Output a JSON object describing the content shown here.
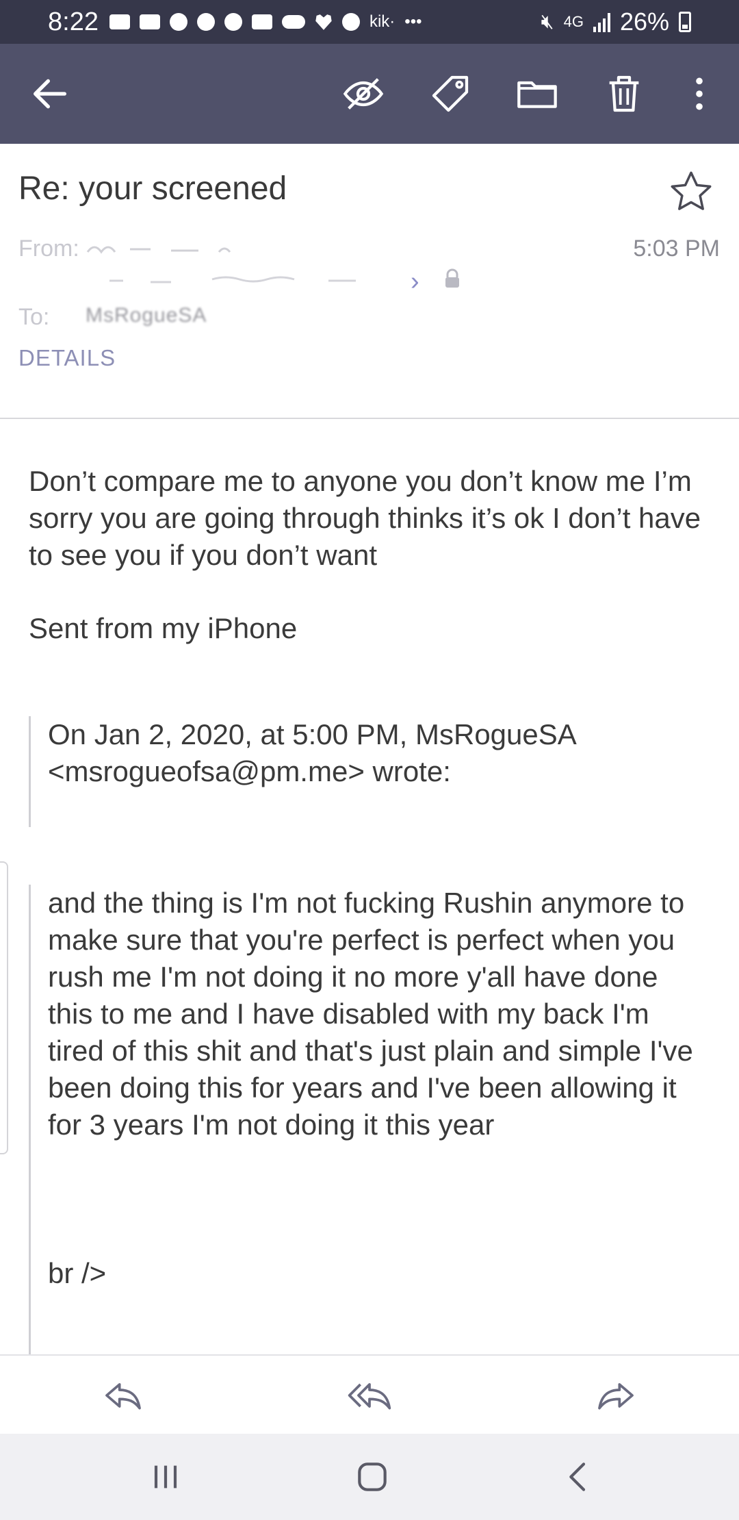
{
  "status_bar": {
    "time": "8:22",
    "battery": "26%",
    "network": "4G",
    "more": "•••",
    "kik": "kik·"
  },
  "toolbar": {
    "back": "back",
    "mark_unread": "mark-unread",
    "label": "label",
    "move": "move-to-folder",
    "delete": "delete",
    "more": "more"
  },
  "message": {
    "subject": "Re: your screened",
    "from_label": "From:",
    "time": "5:03 PM",
    "to_label": "To:",
    "to_value": "MsRogueSA",
    "details_label": "DETAILS",
    "body": "Don’t compare me to anyone you don’t know me I’m sorry you are going through thinks it’s ok I don’t have to see you if you don’t want",
    "signature": "Sent from my iPhone",
    "quote_header": "On Jan 2, 2020, at 5:00 PM, MsRogueSA <msrogueofsa@pm.me> wrote:",
    "quote_body": "and the thing is I'm not fucking Rushin anymore to make sure that you're perfect is perfect when you rush me I'm not doing it no more y'all have done this to me and I have disabled with my back I'm tired of this shit and that's just plain and simple I've been doing this for years and I've been allowing it for 3 years I'm not doing it this year",
    "br_text": "br />"
  },
  "actions": {
    "reply": "reply",
    "reply_all": "reply-all",
    "forward": "forward"
  },
  "colors": {
    "status_bar": "#36374a",
    "toolbar": "#50516a",
    "accent": "#8d8fb5"
  }
}
